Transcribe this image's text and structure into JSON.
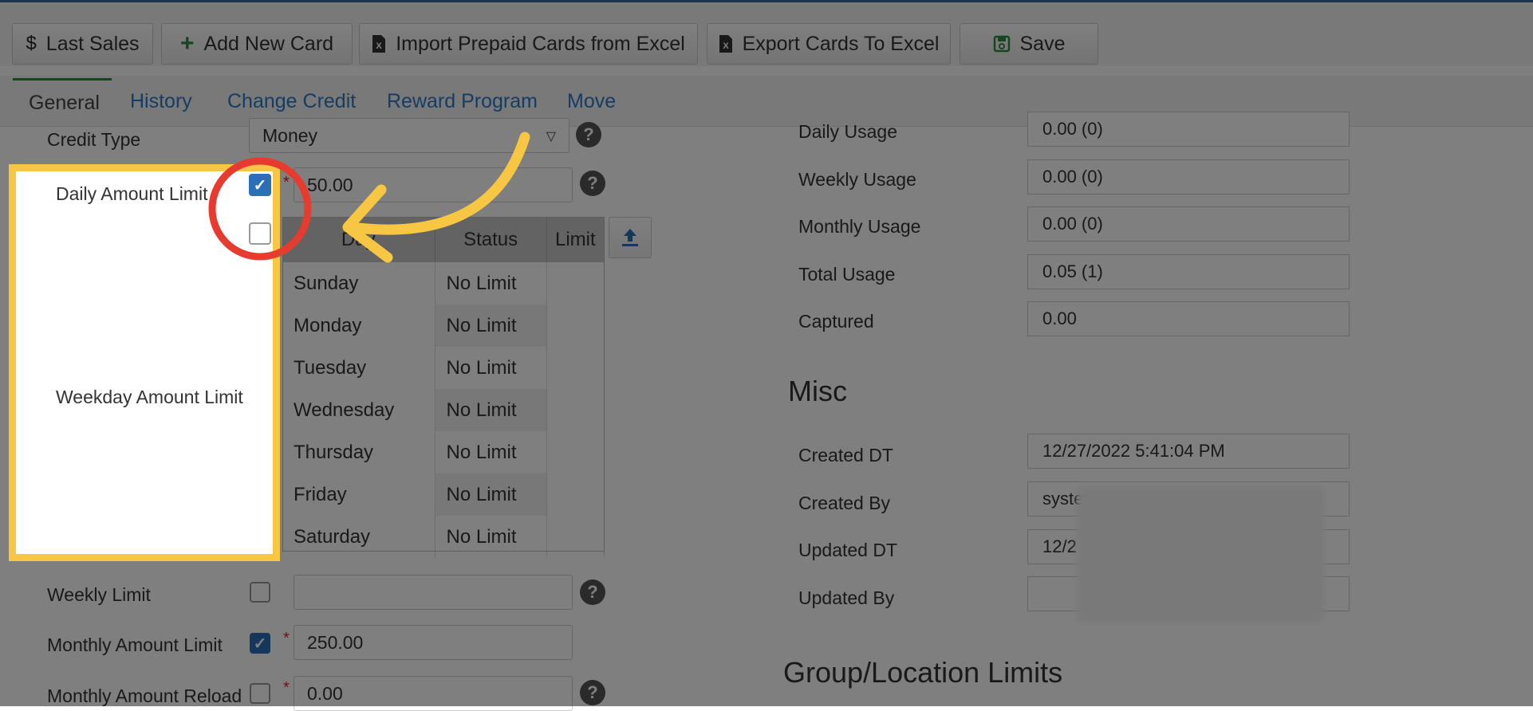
{
  "toolbar": {
    "last_sales": "Last Sales",
    "add_new_card": "Add New Card",
    "import_prepaid": "Import Prepaid Cards from Excel",
    "export_cards": "Export Cards To Excel",
    "save": "Save"
  },
  "tabs": {
    "general": "General",
    "history": "History",
    "change_credit": "Change Credit",
    "reward_program": "Reward Program",
    "move": "Move"
  },
  "form": {
    "credit_type_label": "Credit Type",
    "credit_type_value": "Money",
    "daily_amount_limit_label": "Daily Amount Limit",
    "daily_amount_limit_value": "50.00",
    "weekday_amount_limit_label": "Weekday Amount Limit",
    "weekly_limit_label": "Weekly Limit",
    "monthly_amount_limit_label": "Monthly Amount Limit",
    "monthly_amount_limit_value": "250.00",
    "monthly_amount_reload_label": "Monthly Amount Reload",
    "monthly_amount_reload_value": "0.00",
    "checkboxes": {
      "daily": true,
      "weekday": false,
      "weekly": false,
      "monthly": true,
      "reload": false
    }
  },
  "weekday_table": {
    "headers": [
      "Day",
      "Status",
      "Limit"
    ],
    "rows": [
      {
        "day": "Sunday",
        "status": "No Limit",
        "limit": ""
      },
      {
        "day": "Monday",
        "status": "No Limit",
        "limit": ""
      },
      {
        "day": "Tuesday",
        "status": "No Limit",
        "limit": ""
      },
      {
        "day": "Wednesday",
        "status": "No Limit",
        "limit": ""
      },
      {
        "day": "Thursday",
        "status": "No Limit",
        "limit": ""
      },
      {
        "day": "Friday",
        "status": "No Limit",
        "limit": ""
      },
      {
        "day": "Saturday",
        "status": "No Limit",
        "limit": ""
      }
    ]
  },
  "usage": {
    "daily_usage_label": "Daily Usage",
    "daily_usage_value": "0.00 (0)",
    "weekly_usage_label": "Weekly Usage",
    "weekly_usage_value": "0.00 (0)",
    "monthly_usage_label": "Monthly Usage",
    "monthly_usage_value": "0.00 (0)",
    "total_usage_label": "Total Usage",
    "total_usage_value": "0.05 (1)",
    "captured_label": "Captured",
    "captured_value": "0.00"
  },
  "misc": {
    "title": "Misc",
    "created_dt_label": "Created DT",
    "created_dt_value": "12/27/2022 5:41:04 PM",
    "created_by_label": "Created By",
    "created_by_value": "syste",
    "updated_dt_label": "Updated DT",
    "updated_dt_value": "12/2",
    "updated_by_label": "Updated By",
    "updated_by_value": ""
  },
  "group_location": {
    "title": "Group/Location Limits"
  },
  "colors": {
    "accent": "#2a6fb7",
    "highlight": "#f7c744",
    "annotation_red": "#e63b2e"
  }
}
